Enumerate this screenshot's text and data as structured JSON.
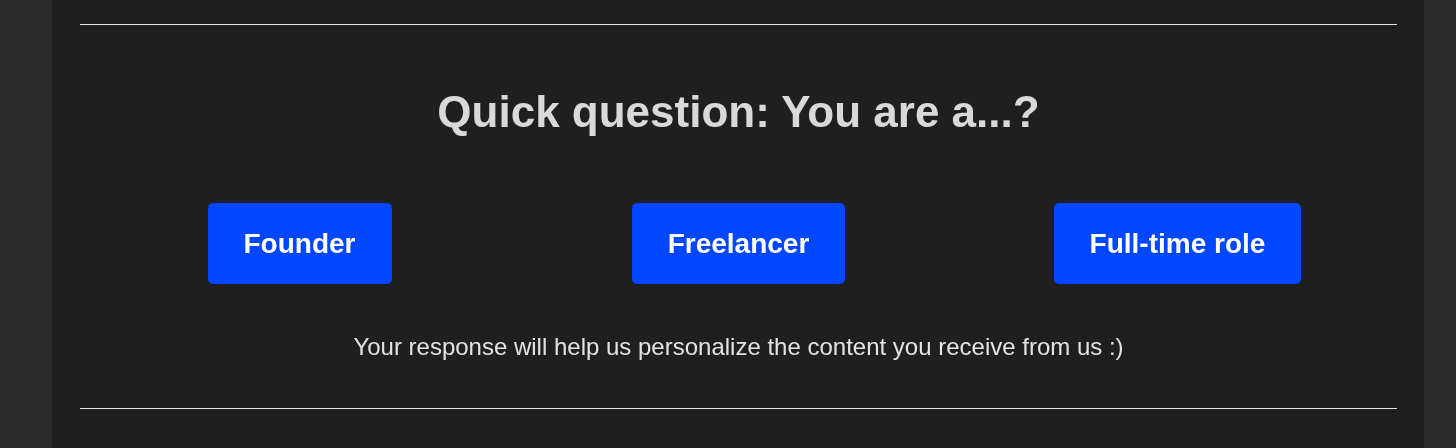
{
  "heading": "Quick question: You are a...?",
  "buttons": [
    {
      "label": "Founder"
    },
    {
      "label": "Freelancer"
    },
    {
      "label": "Full-time role"
    }
  ],
  "note": "Your response will help us personalize the content you receive from us :)"
}
